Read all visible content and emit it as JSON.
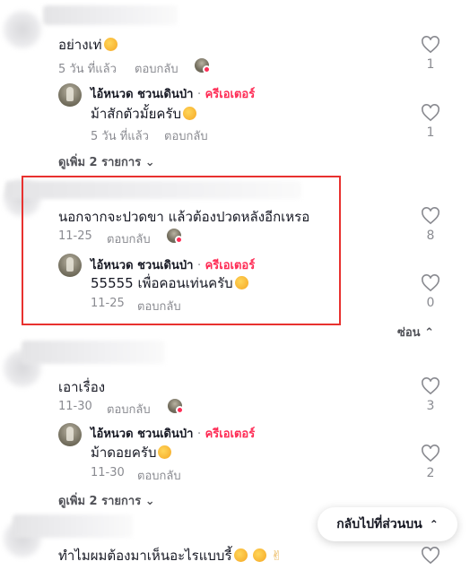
{
  "comments": [
    {
      "text": "อย่างเท่",
      "date": "5 วัน ที่แล้ว",
      "reply_label": "ตอบกลับ",
      "likes": "1",
      "reply": {
        "author": "ไอ้หนวด ชวนเดินป่า",
        "separator": "·",
        "creator_label": "ครีเอเตอร์",
        "text": "ม้าสักตัวมั้ยครับ",
        "date": "5 วัน ที่แล้ว",
        "reply_label": "ตอบกลับ",
        "likes": "1"
      },
      "view_more": "ดูเพิ่ม 2 รายการ"
    },
    {
      "text": "นอกจากจะปวดขา แล้วต้องปวดหลังอีกเหรอ",
      "date": "11-25",
      "reply_label": "ตอบกลับ",
      "likes": "8",
      "reply": {
        "author": "ไอ้หนวด ชวนเดินป่า",
        "separator": "·",
        "creator_label": "ครีเอเตอร์",
        "text": "55555 เพื่อคอนเท่นครับ",
        "date": "11-25",
        "reply_label": "ตอบกลับ",
        "likes": "0"
      },
      "hide_label": "ซ่อน"
    },
    {
      "text": "เอาเรื่อง",
      "date": "11-30",
      "reply_label": "ตอบกลับ",
      "likes": "3",
      "reply": {
        "author": "ไอ้หนวด ชวนเดินป่า",
        "separator": "·",
        "creator_label": "ครีเอเตอร์",
        "text": "ม้าดอยครับ",
        "date": "11-30",
        "reply_label": "ตอบกลับ",
        "likes": "2"
      },
      "view_more": "ดูเพิ่ม 2 รายการ"
    },
    {
      "text": "ทำไมผมต้องมาเห็นอะไรแบบรี้"
    }
  ],
  "back_to_top_label": "กลับไปที่ส่วนบน",
  "colors": {
    "creator": "#fe2c55",
    "meta": "#8a8b91",
    "highlight": "#e8312f"
  }
}
